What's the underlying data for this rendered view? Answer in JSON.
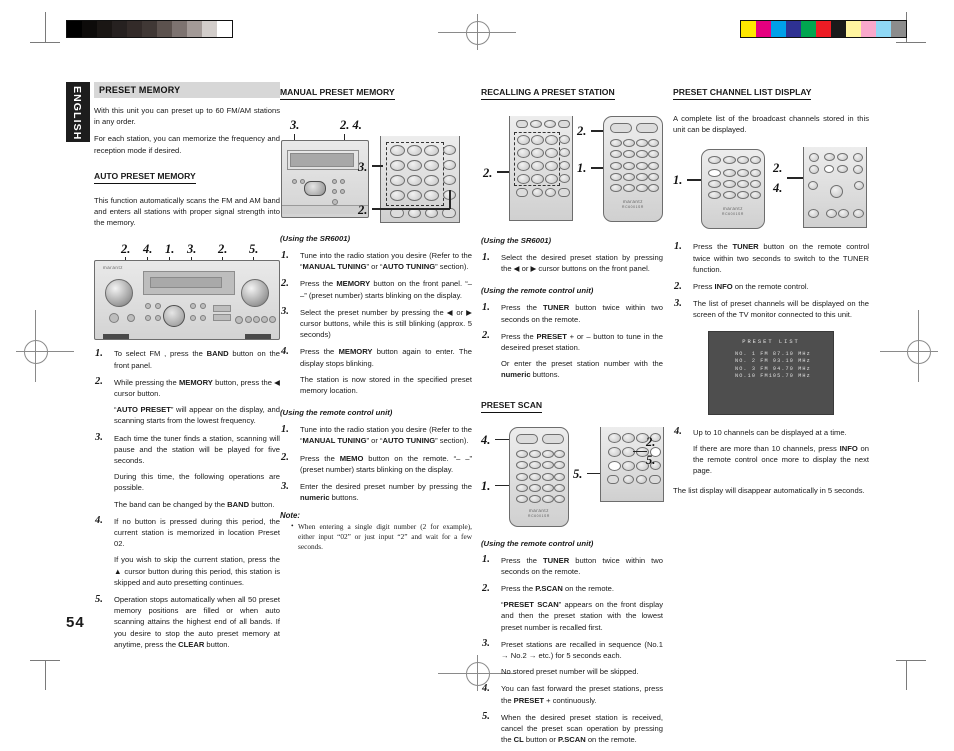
{
  "page": {
    "number": "54",
    "language_tab": "ENGLISH",
    "gray_bar": [
      "#000000",
      "#0d0b0a",
      "#1a1614",
      "#262120",
      "#332b29",
      "#403835",
      "#5c524e",
      "#7d7370",
      "#a39a97",
      "#d2cdca",
      "#ffffff"
    ],
    "color_bar": [
      "#ffe800",
      "#e5007f",
      "#00a0e9",
      "#2e3192",
      "#00a650",
      "#ed1c24",
      "#1a1a1a",
      "#fff4a0",
      "#f9a8cb",
      "#8fd8f5",
      "#8c8c8c"
    ]
  },
  "col1": {
    "section_title": "PRESET MEMORY",
    "intro_1": "With this unit you can preset up to 60 FM/AM stations in any order.",
    "intro_2": "For each station, you can memorize the frequency and reception mode if desired.",
    "sub_title": "AUTO PRESET MEMORY",
    "sub_intro": "This function automatically scans the FM and AM band and enters all stations with proper signal strength into the memory.",
    "figure_callouts": [
      "2.",
      "4.",
      "1.",
      "3.",
      "2.",
      "5."
    ],
    "steps": [
      {
        "num": "1.",
        "paras": [
          "To select FM , press the <b>BAND</b> button on the front panel."
        ]
      },
      {
        "num": "2.",
        "paras": [
          "While pressing the <b>MEMORY</b> button, press the ◀ cursor button.",
          "“<b>AUTO PRESET</b>” will appear on the display, and scanning starts from the lowest frequency."
        ]
      },
      {
        "num": "3.",
        "paras": [
          "Each time the tuner finds a station, scanning will pause and the station will be played for five seconds.",
          "During this time, the following operations are possible.",
          "The band can be changed by the <b>BAND</b> button."
        ]
      },
      {
        "num": "4.",
        "paras": [
          "If no button is pressed during this period, the current station is memorized in location Preset 02.",
          "If you wish to skip the current station, press the ▲ cursor button during this period, this station is skipped and auto presetting continues."
        ]
      },
      {
        "num": "5.",
        "paras": [
          "Operation stops automatically when all 50 preset memory positions are filled or when auto scanning attains the highest end of all bands. If you desire to stop the auto preset memory at anytime, press the <b>CLEAR</b> button."
        ]
      }
    ]
  },
  "col2": {
    "section_title": "MANUAL PRESET MEMORY",
    "figure_callouts": [
      "3.",
      "2. 4.",
      "3.",
      "2."
    ],
    "unit_heading": "(Using the SR6001)",
    "unit_steps": [
      {
        "num": "1.",
        "paras": [
          "Tune into the radio station you desire (Refer to the “<b>MANUAL TUNING</b>” or “<b>AUTO TUNING</b>” section)."
        ]
      },
      {
        "num": "2.",
        "paras": [
          "Press the <b>MEMORY</b> button on the front panel. “– –” (preset number) starts blinking on the display."
        ]
      },
      {
        "num": "3.",
        "paras": [
          "Select the preset number by pressing the ◀ or ▶ cursor buttons, while this is still blinking (approx. 5 seconds)"
        ]
      },
      {
        "num": "4.",
        "paras": [
          "Press the <b>MEMORY</b> button again to enter. The display stops blinking.",
          "The station is now stored in the specified preset memory location."
        ]
      }
    ],
    "remote_heading": "(Using the remote control unit)",
    "remote_steps": [
      {
        "num": "1.",
        "paras": [
          "Tune into the radio station you desire (Refer to the “<b>MANUAL TUNING</b>” or “<b>AUTO TUNING</b>” section)."
        ]
      },
      {
        "num": "2.",
        "paras": [
          "Press the <b>MEMO</b> button on the remote. “– –” (preset number) starts blinking on the display."
        ]
      },
      {
        "num": "3.",
        "paras": [
          "Enter the desired preset number by pressing the <b>numeric</b> buttons."
        ]
      }
    ],
    "note_heading": "Note:",
    "note_items": [
      "When entering a single digit number (2 for example), either input “02” or just input “2” and wait for a few seconds."
    ]
  },
  "col3": {
    "section_title": "RECALLING A PRESET STATION",
    "figure_callouts": [
      "2.",
      "2.",
      "1."
    ],
    "unit_heading": "(Using the SR6001)",
    "unit_steps": [
      {
        "num": "1.",
        "paras": [
          "Select the desired preset station by pressing the ◀ or ▶ cursor buttons on the front panel."
        ]
      }
    ],
    "remote_heading": "(Using the remote control unit)",
    "remote_steps": [
      {
        "num": "1.",
        "paras": [
          "Press the <b>TUNER</b> button twice within two seconds on the remote."
        ]
      },
      {
        "num": "2.",
        "paras": [
          "Press the <b>PRESET</b> + or – button to tune in the deseired preset station.",
          "Or enter the preset station number with the <b>numeric</b> buttons."
        ]
      }
    ],
    "scan_title": "PRESET SCAN",
    "scan_callouts": [
      "4.",
      "1.",
      "5.",
      "2.",
      "5."
    ],
    "scan_heading": "(Using the remote control unit)",
    "scan_steps": [
      {
        "num": "1.",
        "paras": [
          "Press the <b>TUNER</b> button twice within two seconds on the remote."
        ]
      },
      {
        "num": "2.",
        "paras": [
          "Press the <b>P.SCAN</b> on the remote.",
          "“<b>PRESET SCAN</b>” appears on the front display and then the preset station with the lowest preset number is recalled first."
        ]
      },
      {
        "num": "3.",
        "paras": [
          "Preset stations are recalled in sequence (No.1 → No.2 → etc.) for 5 seconds each.",
          "No stored preset number will be skipped."
        ]
      },
      {
        "num": "4.",
        "paras": [
          "You can fast forward the preset stations, press the <b>PRESET</b> + continuously."
        ]
      },
      {
        "num": "5.",
        "paras": [
          "When the desired preset station is received, cancel the preset scan operation by pressing the <b>CL</b> button or <b>P.SCAN</b> on the remote."
        ]
      }
    ]
  },
  "col4": {
    "section_title": "PRESET CHANNEL LIST DISPLAY",
    "intro": "A complete list of the broadcast channels stored in this unit can be displayed.",
    "figure_callouts": [
      "1.",
      "2.",
      "4."
    ],
    "steps": [
      {
        "num": "1.",
        "paras": [
          "Press the <b>TUNER</b> button on the remote control twice within two seconds to switch to the TUNER function."
        ]
      },
      {
        "num": "2.",
        "paras": [
          "Press <b>INFO</b> on the remote control."
        ]
      },
      {
        "num": "3.",
        "paras": [
          "The list of preset channels will be displayed on the screen of the TV monitor connected to this unit."
        ]
      }
    ],
    "osd": {
      "title": "PRESET LIST",
      "rows": [
        "NO. 1 FM 87.10 MHz",
        "NO. 2 FM 93.10 MHz",
        "NO. 3 FM 94.70 MHz",
        "NO.10 FM105.70 MHz"
      ]
    },
    "steps_after": [
      {
        "num": "4.",
        "paras": [
          "Up to 10 channels can be displayed at a time.",
          "If there are more than 10 channels, press <b>INFO</b> on the remote control once more to display the next page."
        ]
      }
    ],
    "closing": "The list display will disappear automatically in 5 seconds."
  }
}
